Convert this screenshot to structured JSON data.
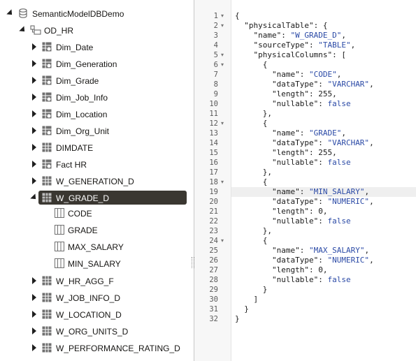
{
  "tree": {
    "root": {
      "label": "SemanticModelDBDemo",
      "icon": "database-icon"
    },
    "schema": {
      "label": "OD_HR",
      "icon": "schema-icon"
    },
    "tables": [
      {
        "label": "Dim_Date",
        "icon": "alias-table-icon"
      },
      {
        "label": "Dim_Generation",
        "icon": "alias-table-icon"
      },
      {
        "label": "Dim_Grade",
        "icon": "alias-table-icon"
      },
      {
        "label": "Dim_Job_Info",
        "icon": "alias-table-icon"
      },
      {
        "label": "Dim_Location",
        "icon": "alias-table-icon"
      },
      {
        "label": "Dim_Org_Unit",
        "icon": "alias-table-icon"
      },
      {
        "label": "DIMDATE",
        "icon": "table-icon"
      },
      {
        "label": "Fact HR",
        "icon": "alias-table-icon"
      },
      {
        "label": "W_GENERATION_D",
        "icon": "table-icon"
      },
      {
        "label": "W_GRADE_D",
        "icon": "table-icon",
        "selected": true
      },
      {
        "label": "W_HR_AGG_F",
        "icon": "table-icon"
      },
      {
        "label": "W_JOB_INFO_D",
        "icon": "table-icon"
      },
      {
        "label": "W_LOCATION_D",
        "icon": "table-icon"
      },
      {
        "label": "W_ORG_UNITS_D",
        "icon": "table-icon"
      },
      {
        "label": "W_PERFORMANCE_RATING_D",
        "icon": "table-icon"
      }
    ],
    "columns": [
      "CODE",
      "GRADE",
      "MAX_SALARY",
      "MIN_SALARY"
    ]
  },
  "editor": {
    "line_numbers": [
      "1",
      "2",
      "3",
      "4",
      "5",
      "6",
      "7",
      "8",
      "9",
      "10",
      "11",
      "12",
      "13",
      "14",
      "15",
      "16",
      "17",
      "18",
      "19",
      "20",
      "21",
      "22",
      "23",
      "24",
      "25",
      "26",
      "27",
      "28",
      "29",
      "30",
      "31",
      "32"
    ],
    "fold_markers": [
      "1",
      "2",
      "5",
      "6",
      "12",
      "18",
      "24"
    ],
    "lines": [
      "{",
      "  \"physicalTable\": {",
      "    \"name\": \"W_GRADE_D\",",
      "    \"sourceType\": \"TABLE\",",
      "    \"physicalColumns\": [",
      "      {",
      "        \"name\": \"CODE\",",
      "        \"dataType\": \"VARCHAR\",",
      "        \"length\": 255,",
      "        \"nullable\": false",
      "      },",
      "      {",
      "        \"name\": \"GRADE\",",
      "        \"dataType\": \"VARCHAR\",",
      "        \"length\": 255,",
      "        \"nullable\": false",
      "      },",
      "      {",
      "        \"name\": \"MIN_SALARY\",",
      "        \"dataType\": \"NUMERIC\",",
      "        \"length\": 0,",
      "        \"nullable\": false",
      "      },",
      "      {",
      "        \"name\": \"MAX_SALARY\",",
      "        \"dataType\": \"NUMERIC\",",
      "        \"length\": 0,",
      "        \"nullable\": false",
      "      }",
      "    ]",
      "  }",
      "}"
    ],
    "highlighted_line": "19"
  },
  "colors": {
    "selection": "#3a3731",
    "string": "#2b4aa6",
    "gutter": "#f7f7f7"
  }
}
